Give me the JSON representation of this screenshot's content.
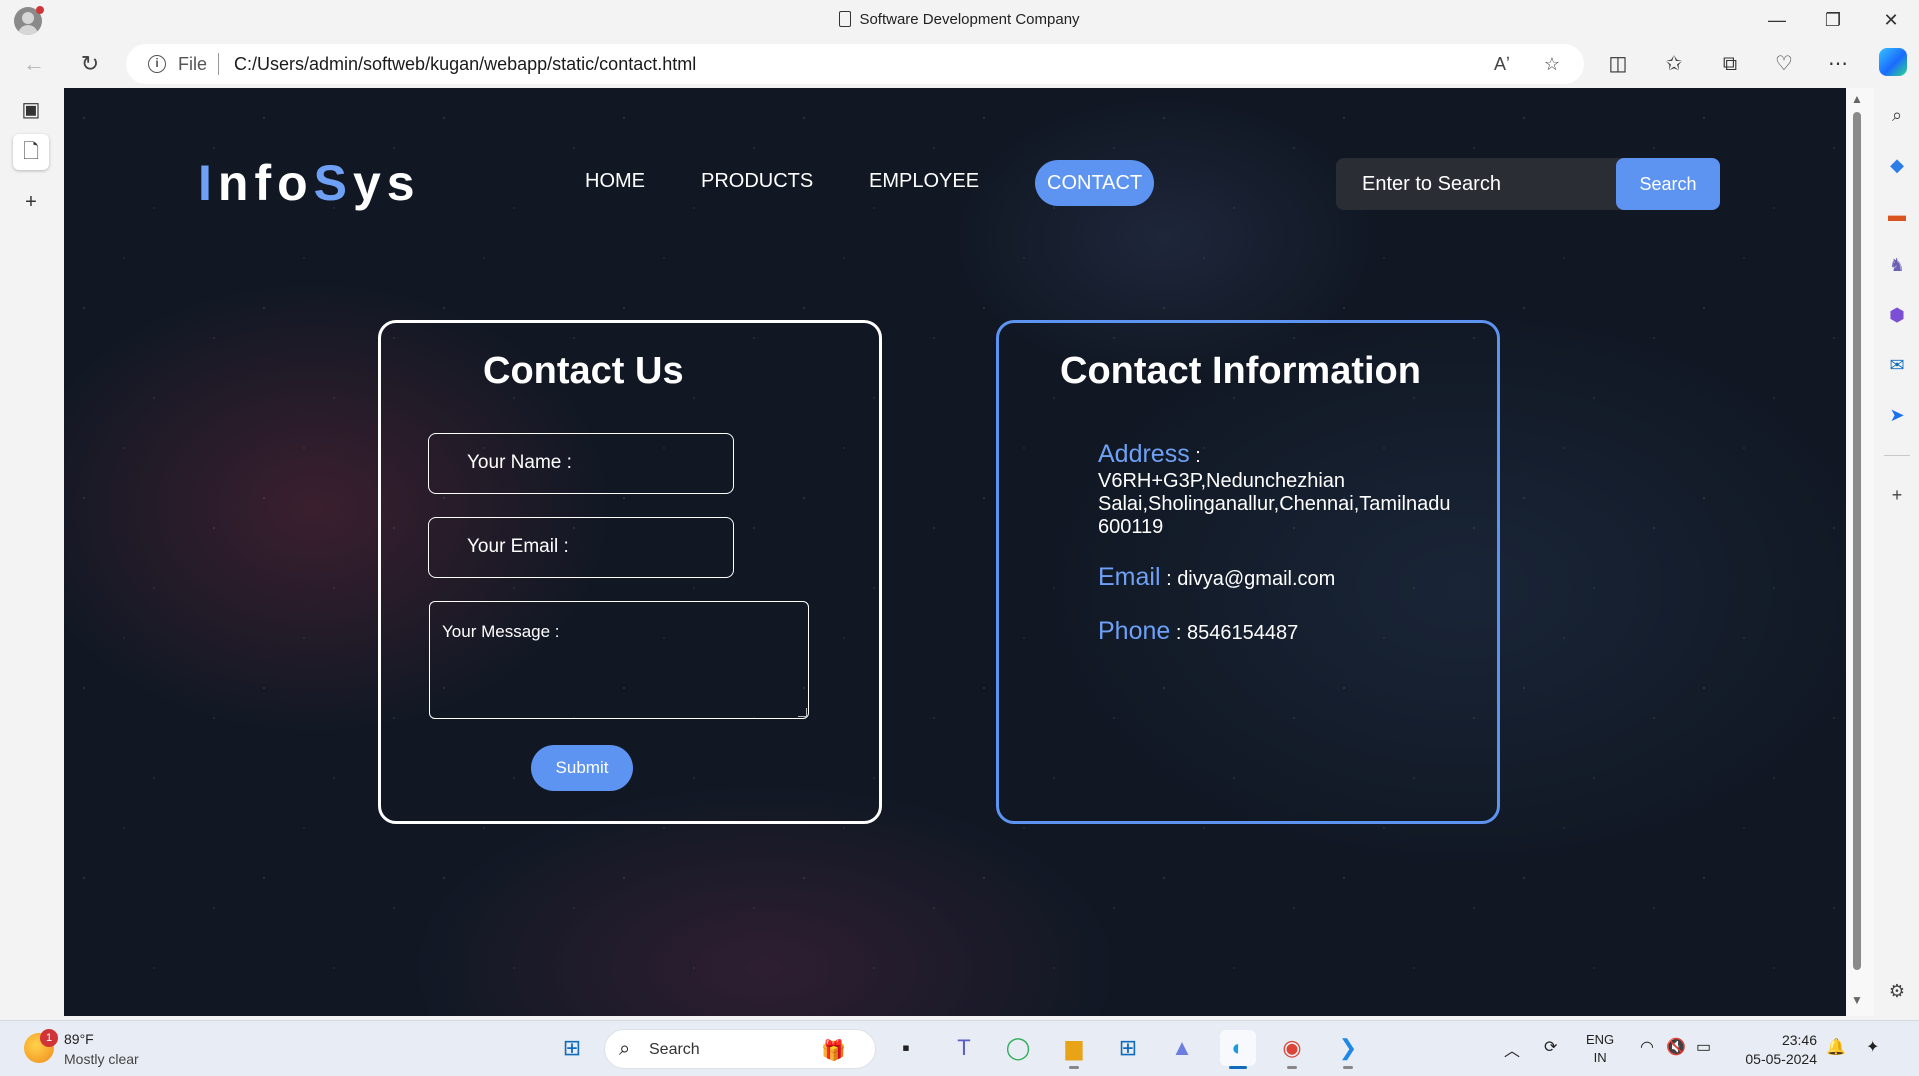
{
  "window": {
    "title": "Software Development Company",
    "minimize": "—",
    "restore": "❐",
    "close": "✕"
  },
  "address_bar": {
    "scheme_label": "File",
    "url": "C:/Users/admin/softweb/kugan/webapp/static/contact.html"
  },
  "site": {
    "logo": {
      "part1": "I",
      "part2": "nfo",
      "part3": "S",
      "part4": "ys"
    },
    "nav": [
      {
        "label": "HOME"
      },
      {
        "label": "PRODUCTS"
      },
      {
        "label": "EMPLOYEE"
      },
      {
        "label": "CONTACT",
        "active": true
      }
    ],
    "search": {
      "placeholder": "Enter to Search",
      "button": "Search"
    },
    "contact_form": {
      "title": "Contact Us",
      "name_placeholder": "Your Name :",
      "email_placeholder": "Your Email :",
      "message_placeholder": "Your Message :",
      "submit": "Submit"
    },
    "contact_info": {
      "title": "Contact Information",
      "address_label": "Address",
      "address_value": "V6RH+G3P,Nedunchezhian Salai,Sholinganallur,Chennai,Tamilnadu 600119",
      "email_label": "Email",
      "email_value": "divya@gmail.com",
      "phone_label": "Phone",
      "phone_value": "8546154487",
      "separator": " : "
    },
    "accent_color": "#5d93f1"
  },
  "taskbar": {
    "weather": {
      "temp": "89°F",
      "condition": "Mostly clear",
      "badge": "1"
    },
    "search_label": "Search",
    "language": {
      "line1": "ENG",
      "line2": "IN"
    },
    "time": "23:46",
    "date": "05-05-2024"
  }
}
